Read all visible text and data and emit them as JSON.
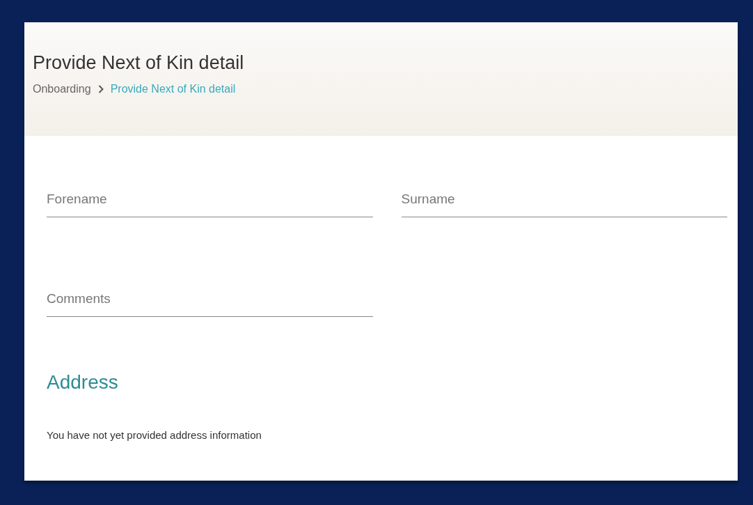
{
  "page": {
    "title": "Provide Next of Kin detail"
  },
  "breadcrumb": [
    {
      "label": "Onboarding",
      "current": false
    },
    {
      "label": "Provide Next of Kin detail",
      "current": true
    }
  ],
  "form_rows": [
    [
      {
        "placeholder": "Forename"
      },
      {
        "placeholder": "Surname"
      }
    ],
    [
      {
        "placeholder": "Comments"
      }
    ]
  ],
  "address": {
    "heading": "Address",
    "message": "You have not yet provided address information"
  }
}
